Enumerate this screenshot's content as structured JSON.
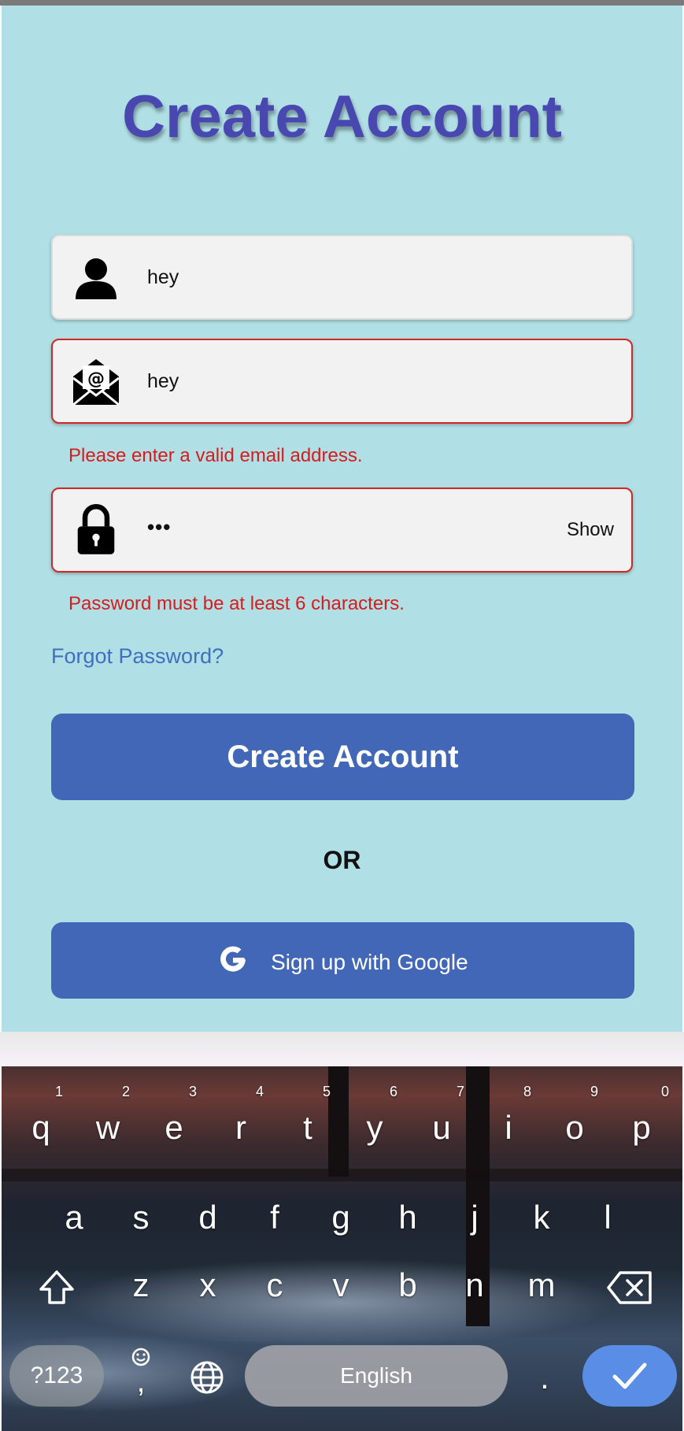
{
  "form": {
    "title": "Create Account",
    "name_value": "hey",
    "email_value": "hey",
    "email_error": "Please enter a valid email address.",
    "password_value": "•••",
    "password_toggle": "Show",
    "password_error": "Password must be at least 6 characters.",
    "forgot_password": "Forgot Password?",
    "submit_label": "Create Account",
    "divider": "OR",
    "google_label": "Sign up with Google"
  },
  "colors": {
    "background": "#b0e0e5",
    "title": "#4848b0",
    "button": "#4267b6",
    "error": "#d32626",
    "link": "#3f6fc0"
  },
  "keyboard": {
    "row1": [
      "q",
      "w",
      "e",
      "r",
      "t",
      "y",
      "u",
      "i",
      "o",
      "p"
    ],
    "row1_numbers": [
      "1",
      "2",
      "3",
      "4",
      "5",
      "6",
      "7",
      "8",
      "9",
      "0"
    ],
    "row2": [
      "a",
      "s",
      "d",
      "f",
      "g",
      "h",
      "j",
      "k",
      "l"
    ],
    "row3": [
      "z",
      "x",
      "c",
      "v",
      "b",
      "n",
      "m"
    ],
    "symbols_key": "?123",
    "comma_key": ",",
    "space_label": "English",
    "period_key": ".",
    "icons": [
      "shift-icon",
      "backspace-icon",
      "emoji-icon",
      "globe-icon",
      "checkmark-icon"
    ]
  }
}
